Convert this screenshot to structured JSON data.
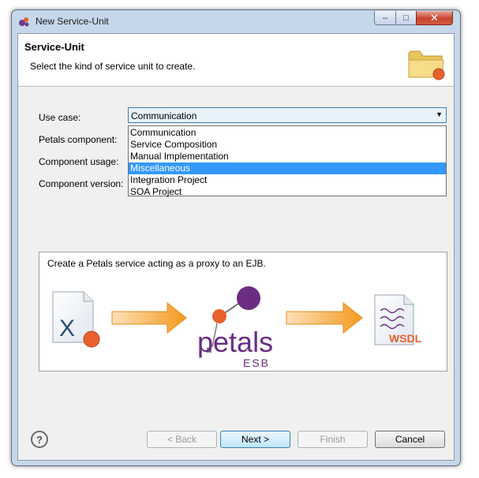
{
  "window": {
    "title": "New Service-Unit",
    "controls": {
      "minimize": "–",
      "maximize": "□",
      "close": "✕"
    }
  },
  "header": {
    "title": "Service-Unit",
    "description": "Select the kind of service unit to create.",
    "icon": "folder-icon"
  },
  "form": {
    "use_case_label": "Use case:",
    "petals_component_label": "Petals component:",
    "component_usage_label": "Component usage:",
    "component_version_label": "Component version:",
    "use_case_value": "Communication"
  },
  "dropdown": {
    "options": [
      "Communication",
      "Service Composition",
      "Manual Implementation",
      "Miscellaneous",
      "Integration Project",
      "SOA Project"
    ],
    "highlighted": "Miscellaneous"
  },
  "illustration": {
    "text": "Create a Petals service acting as a proxy to an EJB.",
    "logo_text": "petals",
    "logo_sub": "ESB",
    "wsdl_label": "WSDL",
    "x_letter": "X"
  },
  "buttons": {
    "back": "< Back",
    "next": "Next >",
    "finish": "Finish",
    "cancel": "Cancel",
    "help": "?"
  },
  "colors": {
    "selection": "#3399ff",
    "arrow": "#f39a1e",
    "petals_purple": "#6b2c82",
    "accent_orange": "#e8612c"
  }
}
